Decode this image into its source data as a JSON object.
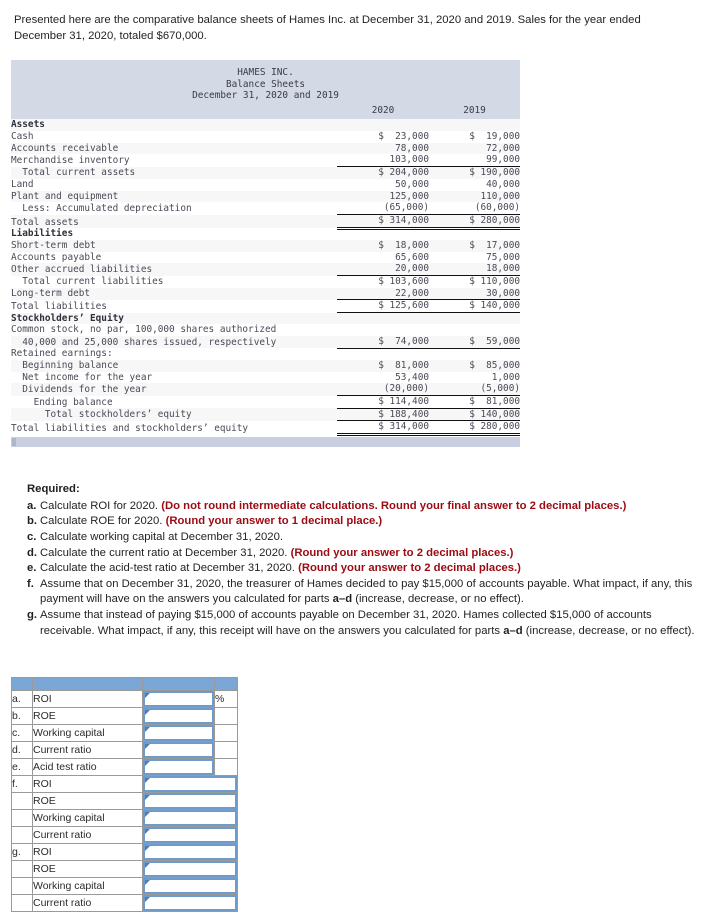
{
  "intro": "Presented here are the comparative balance sheets of Hames Inc. at December 31, 2020 and 2019. Sales for the year ended December 31, 2020, totaled $670,000.",
  "balance_sheet": {
    "company": "HAMES INC.",
    "statement": "Balance Sheets",
    "date_line": "December 31, 2020 and 2019",
    "col_headers": [
      "2020",
      "2019"
    ],
    "rows": [
      {
        "label": "Assets",
        "bold": true,
        "v1": "",
        "v2": "",
        "style": ""
      },
      {
        "label": "Cash",
        "v1": "$  23,000",
        "v2": "$  19,000",
        "style": ""
      },
      {
        "label": "Accounts receivable",
        "v1": "78,000",
        "v2": "72,000",
        "style": ""
      },
      {
        "label": "Merchandise inventory",
        "v1": "103,000",
        "v2": "99,000",
        "style": "u"
      },
      {
        "label": "  Total current assets",
        "v1": "$ 204,000",
        "v2": "$ 190,000",
        "style": ""
      },
      {
        "label": "Land",
        "v1": "50,000",
        "v2": "40,000",
        "style": ""
      },
      {
        "label": "Plant and equipment",
        "v1": "125,000",
        "v2": "110,000",
        "style": ""
      },
      {
        "label": "  Less: Accumulated depreciation",
        "v1": "(65,000)",
        "v2": "(60,000)",
        "style": "u"
      },
      {
        "label": "Total assets",
        "v1": "$ 314,000",
        "v2": "$ 280,000",
        "style": "dd"
      },
      {
        "label": "Liabilities",
        "bold": true,
        "v1": "",
        "v2": "",
        "style": ""
      },
      {
        "label": "Short-term debt",
        "v1": "$  18,000",
        "v2": "$  17,000",
        "style": ""
      },
      {
        "label": "Accounts payable",
        "v1": "65,600",
        "v2": "75,000",
        "style": ""
      },
      {
        "label": "Other accrued liabilities",
        "v1": "20,000",
        "v2": "18,000",
        "style": "u"
      },
      {
        "label": "  Total current liabilities",
        "v1": "$ 103,600",
        "v2": "$ 110,000",
        "style": ""
      },
      {
        "label": "Long-term debt",
        "v1": "22,000",
        "v2": "30,000",
        "style": "u"
      },
      {
        "label": "Total liabilities",
        "v1": "$ 125,600",
        "v2": "$ 140,000",
        "style": "u"
      },
      {
        "label": "Stockholders’ Equity",
        "bold": true,
        "v1": "",
        "v2": "",
        "style": ""
      },
      {
        "label": "Common stock, no par, 100,000 shares authorized",
        "v1": "",
        "v2": "",
        "style": ""
      },
      {
        "label": "  40,000 and 25,000 shares issued, respectively",
        "v1": "$  74,000",
        "v2": "$  59,000",
        "style": "u"
      },
      {
        "label": "Retained earnings:",
        "v1": "",
        "v2": "",
        "style": ""
      },
      {
        "label": "  Beginning balance",
        "v1": "$  81,000",
        "v2": "$  85,000",
        "style": ""
      },
      {
        "label": "  Net income for the year",
        "v1": "53,400",
        "v2": "1,000",
        "style": ""
      },
      {
        "label": "  Dividends for the year",
        "v1": "(20,000)",
        "v2": "(5,000)",
        "style": "u"
      },
      {
        "label": "    Ending balance",
        "v1": "$ 114,400",
        "v2": "$  81,000",
        "style": "u"
      },
      {
        "label": "      Total stockholders’ equity",
        "v1": "$ 188,400",
        "v2": "$ 140,000",
        "style": "u"
      },
      {
        "label": "Total liabilities and stockholders’ equity",
        "v1": "$ 314,000",
        "v2": "$ 280,000",
        "style": "dd"
      }
    ]
  },
  "required": {
    "title": "Required:",
    "items": [
      {
        "letter": "a.",
        "text": "Calculate ROI for 2020. ",
        "hl": "(Do not round intermediate calculations. Round your final answer to 2 decimal places.)",
        "tail": ""
      },
      {
        "letter": "b.",
        "text": "Calculate ROE for 2020. ",
        "hl": "(Round your answer to 1 decimal place.)",
        "tail": ""
      },
      {
        "letter": "c.",
        "text": "Calculate working capital at December 31, 2020.",
        "hl": "",
        "tail": ""
      },
      {
        "letter": "d.",
        "text": "Calculate the current ratio at December 31, 2020. ",
        "hl": "(Round your answer to 2 decimal places.)",
        "tail": ""
      },
      {
        "letter": "e.",
        "text": "Calculate the acid-test ratio at December 31, 2020. ",
        "hl": "(Round your answer to 2 decimal places.)",
        "tail": ""
      },
      {
        "letter": "f.",
        "text": "Assume that on December 31, 2020, the treasurer of Hames decided to pay $15,000 of accounts payable. What impact, if any, this payment will have on the answers you calculated for parts ",
        "hl": "",
        "bold_ref": "a–d",
        "tail": " (increase, decrease, or no effect)."
      },
      {
        "letter": "g.",
        "text": "Assume that instead of paying $15,000 of accounts payable on December 31, 2020. Hames collected $15,000 of accounts receivable. What impact, if any, this receipt will have on the answers you calculated for parts ",
        "hl": "",
        "bold_ref": "a–d",
        "tail": " (increase, decrease, or no effect)."
      }
    ]
  },
  "answer_table": {
    "percent_symbol": "%",
    "rows": [
      {
        "letter": "a.",
        "label": "ROI",
        "wide": false,
        "pct": "%"
      },
      {
        "letter": "b.",
        "label": "ROE",
        "wide": false,
        "pct": ""
      },
      {
        "letter": "c.",
        "label": "Working capital",
        "wide": false,
        "pct": ""
      },
      {
        "letter": "d.",
        "label": "Current ratio",
        "wide": false,
        "pct": ""
      },
      {
        "letter": "e.",
        "label": "Acid test ratio",
        "wide": false,
        "pct": ""
      },
      {
        "letter": "f.",
        "label": "ROI",
        "wide": true,
        "pct": ""
      },
      {
        "letter": "",
        "label": "ROE",
        "wide": true,
        "pct": ""
      },
      {
        "letter": "",
        "label": "Working capital",
        "wide": true,
        "pct": ""
      },
      {
        "letter": "",
        "label": "Current ratio",
        "wide": true,
        "pct": ""
      },
      {
        "letter": "g.",
        "label": "ROI",
        "wide": true,
        "pct": ""
      },
      {
        "letter": "",
        "label": "ROE",
        "wide": true,
        "pct": ""
      },
      {
        "letter": "",
        "label": "Working capital",
        "wide": true,
        "pct": ""
      },
      {
        "letter": "",
        "label": "Current ratio",
        "wide": true,
        "pct": ""
      }
    ]
  }
}
